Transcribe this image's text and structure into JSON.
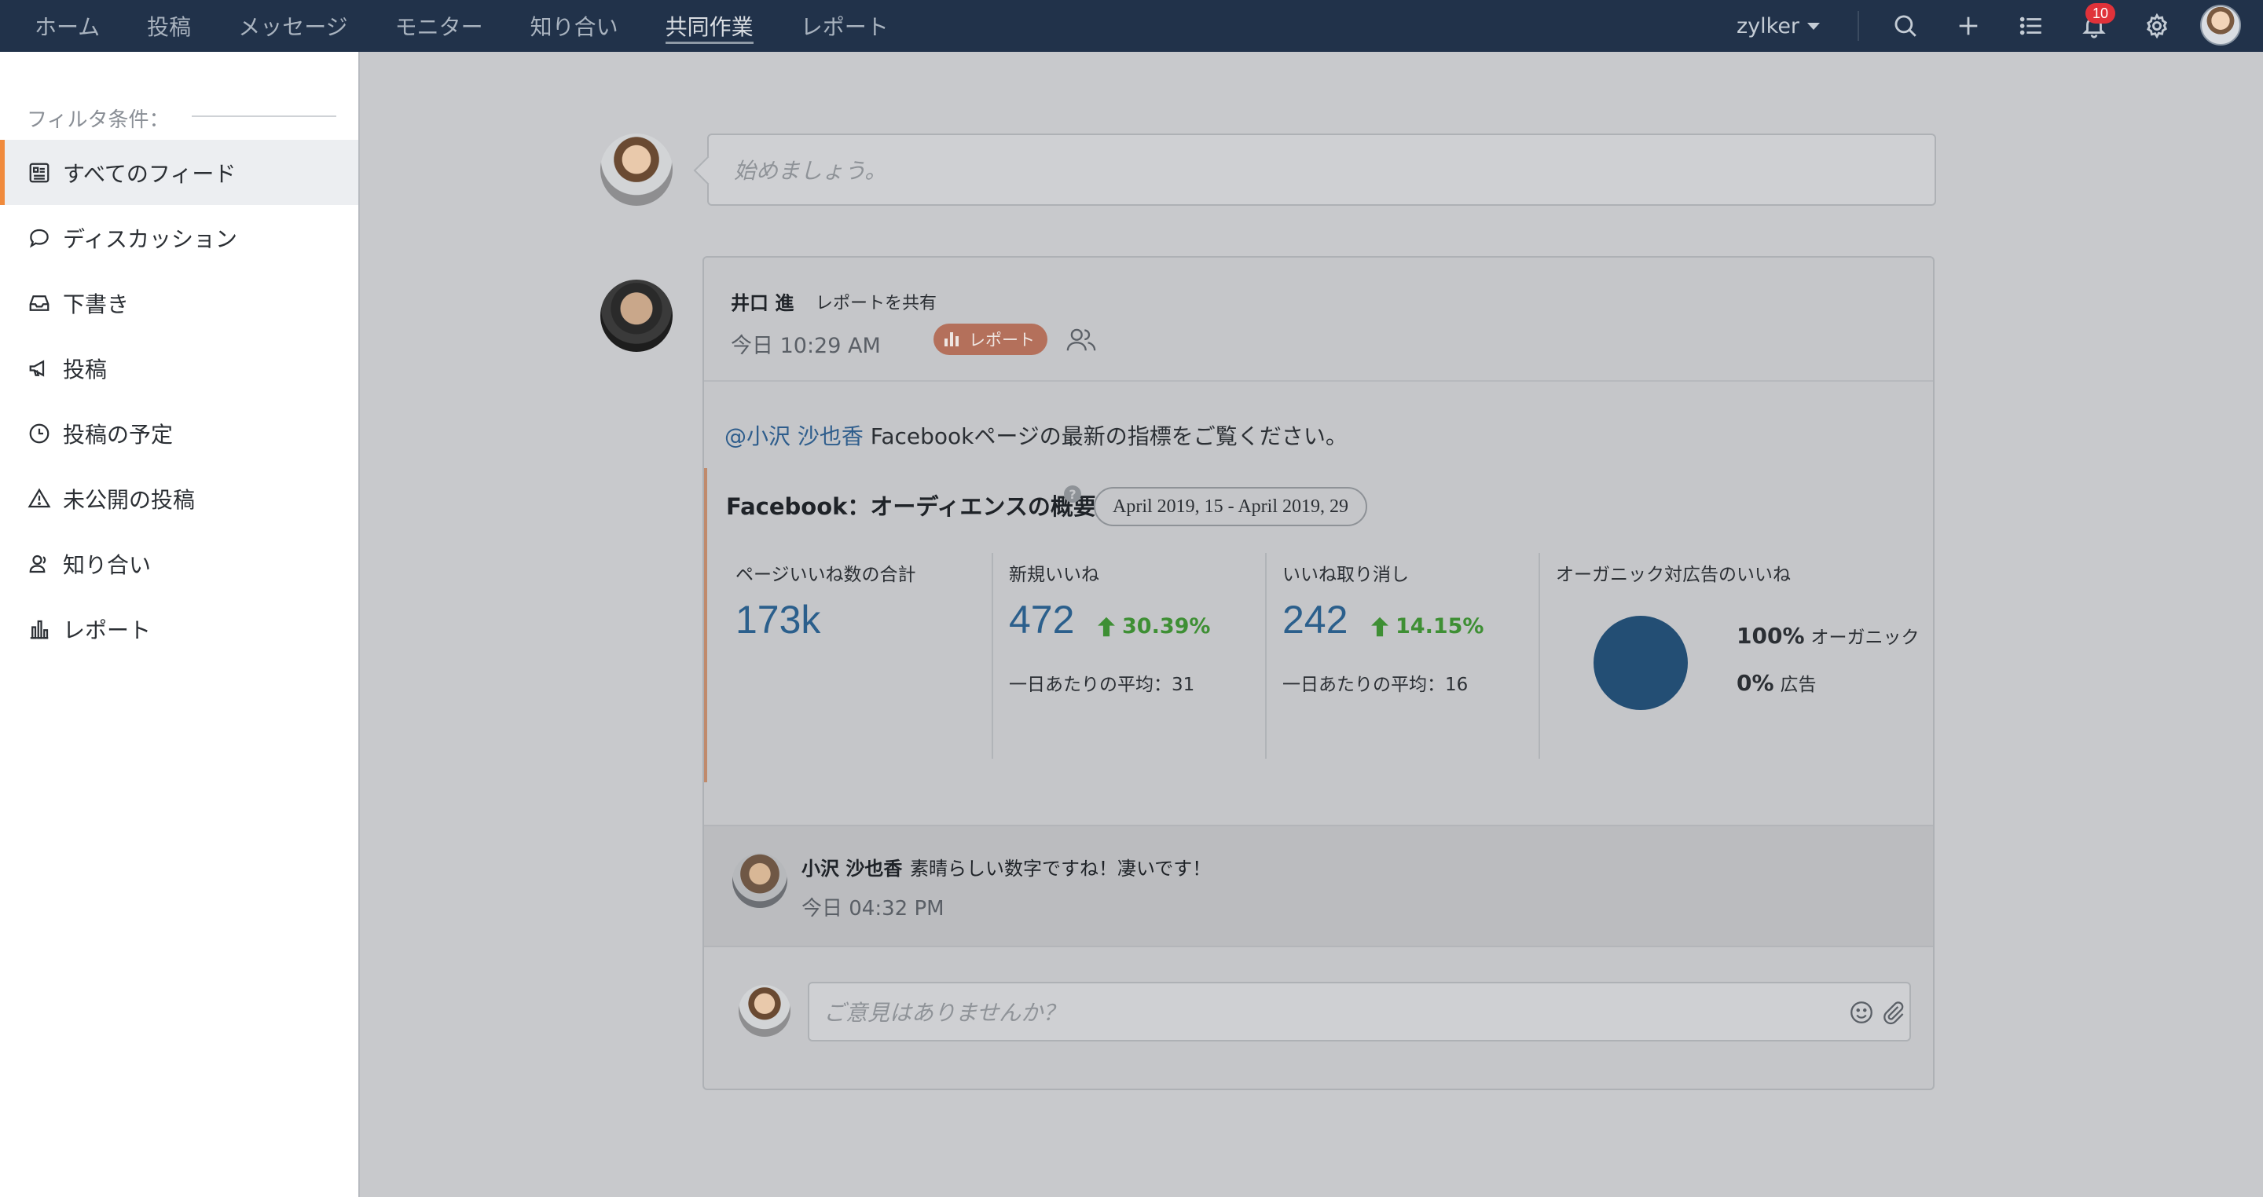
{
  "nav": {
    "tabs": [
      "ホーム",
      "投稿",
      "メッセージ",
      "モニター",
      "知り合い",
      "共同作業",
      "レポート"
    ],
    "active_tab": "共同作業",
    "org_name": "zylker",
    "notification_count": "10",
    "icons": [
      "search-icon",
      "plus-icon",
      "list-icon",
      "bell-icon",
      "gear-icon"
    ]
  },
  "sidebar": {
    "filter_label": "フィルタ条件：",
    "items": [
      {
        "label": "すべてのフィード",
        "icon": "feed-icon",
        "active": true
      },
      {
        "label": "ディスカッション",
        "icon": "chat-icon",
        "active": false
      },
      {
        "label": "下書き",
        "icon": "inbox-icon",
        "active": false
      },
      {
        "label": "投稿",
        "icon": "megaphone-icon",
        "active": false
      },
      {
        "label": "投稿の予定",
        "icon": "clock-icon",
        "active": false
      },
      {
        "label": "未公開の投稿",
        "icon": "warning-icon",
        "active": false
      },
      {
        "label": "知り合い",
        "icon": "contacts-icon",
        "active": false
      },
      {
        "label": "レポート",
        "icon": "bar-chart-icon",
        "active": false
      }
    ]
  },
  "composer": {
    "placeholder": "始めましょう。"
  },
  "post": {
    "author": "井口 進",
    "action": "レポートを共有",
    "time": "今日 10:29 AM",
    "tag": "レポート",
    "mention": "@小沢 沙也香",
    "message": " Facebookページの最新の指標をご覧ください。",
    "report": {
      "title": "Facebook：オーディエンスの概要",
      "help": "?",
      "date_range": "April 2019, 15 - April 2019, 29",
      "metrics": [
        {
          "label": "ページいいね数の合計",
          "value": "173k"
        },
        {
          "label": "新規いいね",
          "value": "472",
          "change": "30.39%",
          "avg": "一日あたりの平均：31"
        },
        {
          "label": "いいね取り消し",
          "value": "242",
          "change": "14.15%",
          "avg": "一日あたりの平均：16"
        }
      ],
      "organic_vs_paid": {
        "label": "オーガニック対広告のいいね",
        "organic_pct": "100%",
        "organic_label": "オーガニック",
        "paid_pct": "0%",
        "paid_label": "広告",
        "organic_value": 100,
        "paid_value": 0,
        "color": "#234e74"
      }
    },
    "comment": {
      "author": "小沢 沙也香",
      "text": "素晴らしい数字ですね！凄いです！",
      "time": "今日 04:32 PM"
    },
    "reply": {
      "placeholder": "ご意見はありませんか？"
    }
  }
}
